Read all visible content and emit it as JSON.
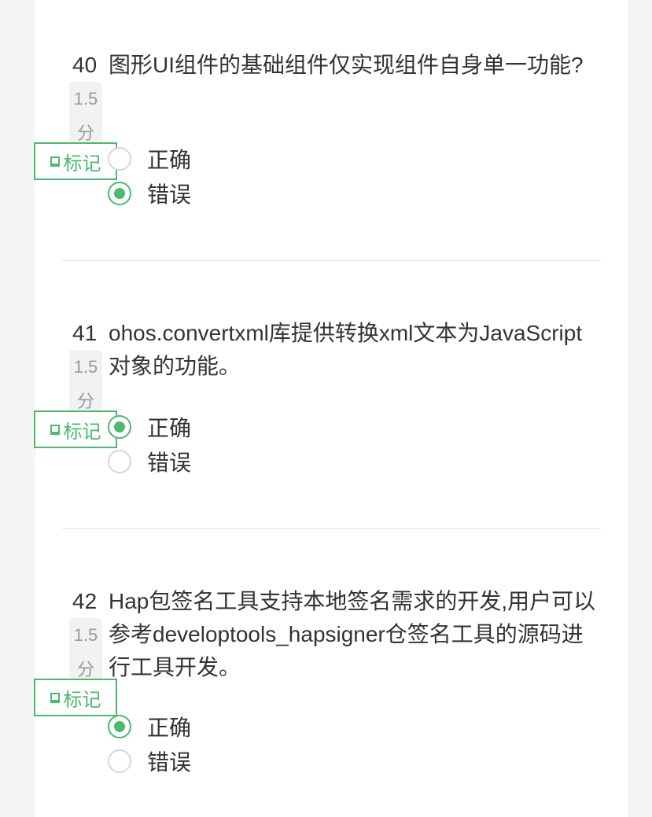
{
  "questions": [
    {
      "number": "40",
      "text": "图形UI组件的基础组件仅实现组件自身单一功能?",
      "score": "1.5",
      "score_unit": "分",
      "mark_label": "标记",
      "options": [
        {
          "label": "正确",
          "selected": false
        },
        {
          "label": "错误",
          "selected": true
        }
      ]
    },
    {
      "number": "41",
      "text": "ohos.convertxml库提供转换xml文本为JavaScript对象的功能。",
      "score": "1.5",
      "score_unit": "分",
      "mark_label": "标记",
      "options": [
        {
          "label": "正确",
          "selected": true
        },
        {
          "label": "错误",
          "selected": false
        }
      ]
    },
    {
      "number": "42",
      "text": "Hap包签名工具支持本地签名需求的开发,用户可以参考developtools_hapsigner仓签名工具的源码进行工具开发。",
      "score": "1.5",
      "score_unit": "分",
      "mark_label": "标记",
      "options": [
        {
          "label": "正确",
          "selected": true
        },
        {
          "label": "错误",
          "selected": false
        }
      ]
    }
  ],
  "colors": {
    "accent": "#4cb971",
    "background": "#f5f5f5",
    "card": "#ffffff",
    "divider": "#e5e5e5"
  }
}
